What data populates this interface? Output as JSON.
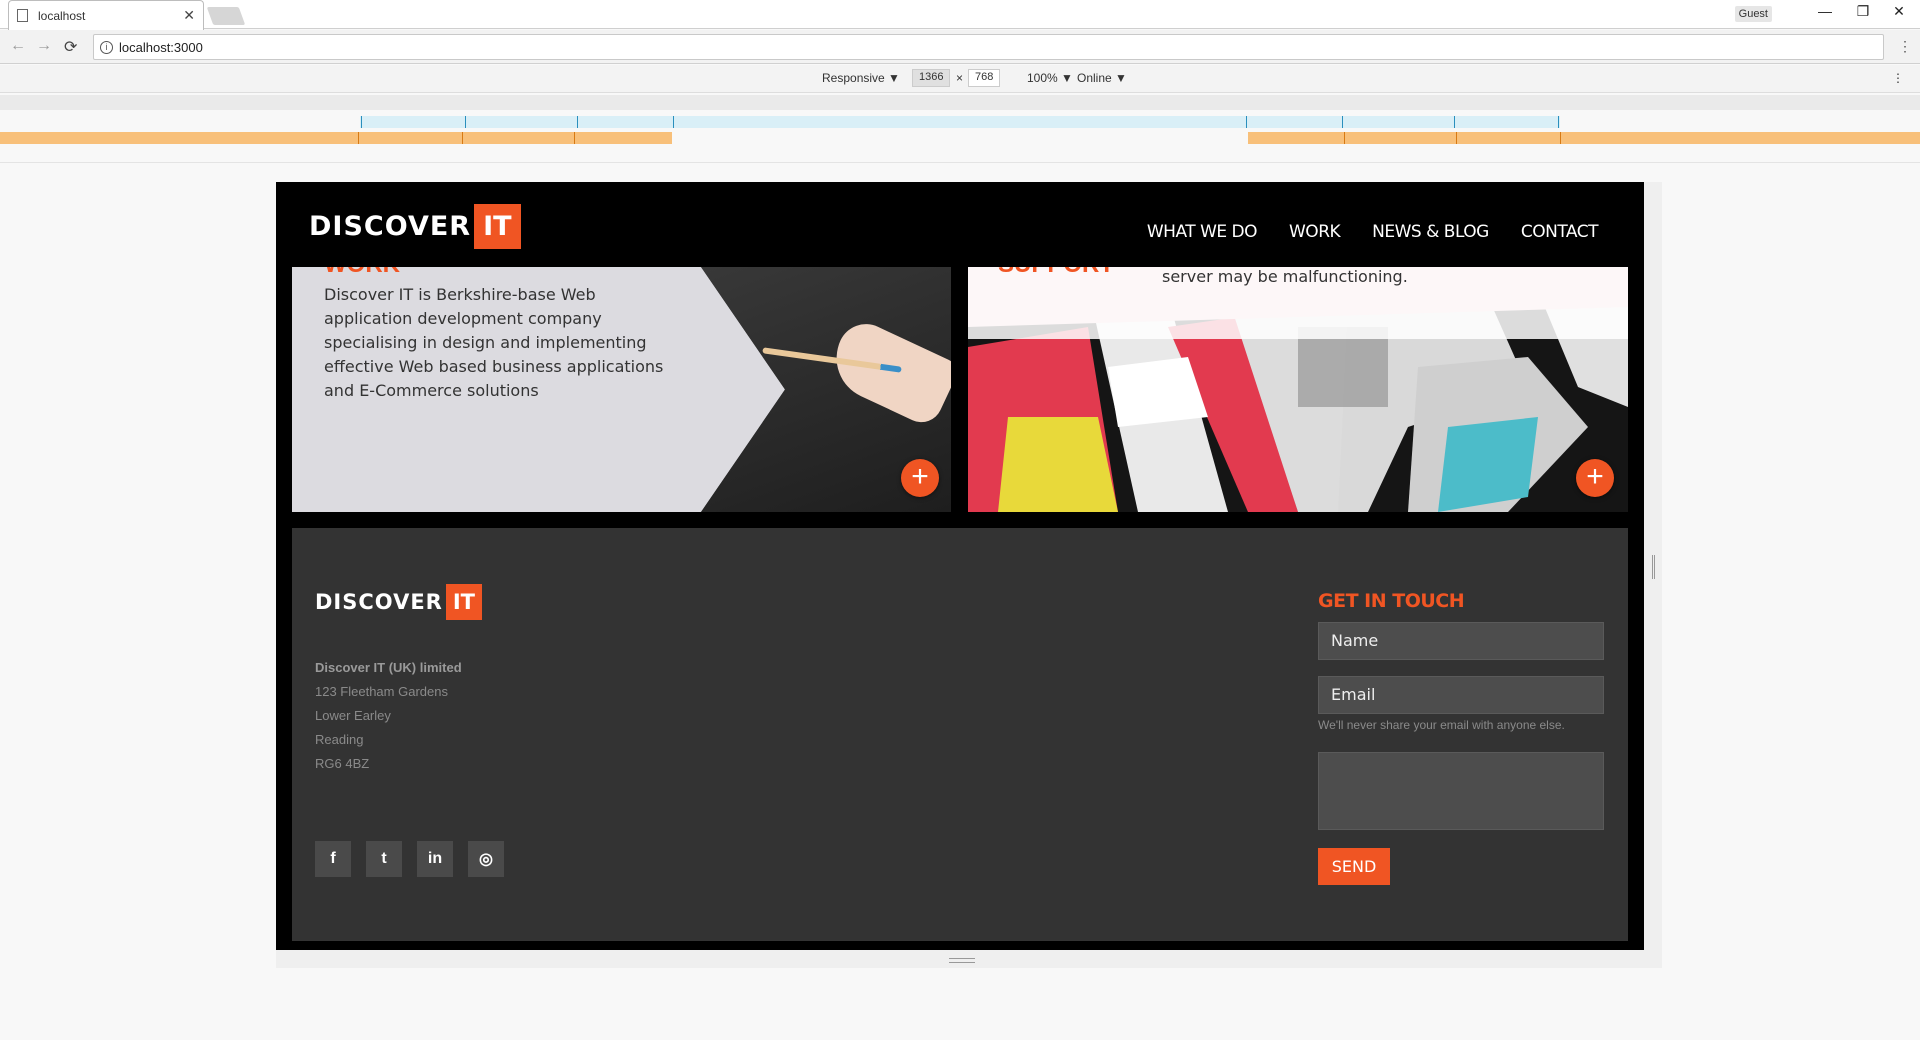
{
  "browser": {
    "tab_title": "localhost",
    "tab_close": "✕",
    "guest_label": "Guest",
    "url": "localhost:3000",
    "window_controls": {
      "minimize": "—",
      "restore": "❐",
      "close": "✕"
    }
  },
  "devtools": {
    "device": "Responsive ▼",
    "width": "1366",
    "times": "×",
    "height": "768",
    "zoom": "100% ▼",
    "network": "Online ▼",
    "more": "⋮"
  },
  "site": {
    "logo_word": "DISCOVER",
    "logo_it": "IT",
    "nav": [
      "WHAT WE DO",
      "WORK",
      "NEWS & BLOG",
      "CONTACT"
    ],
    "cards": {
      "left_title_fragment": "WORK",
      "left_text": "Discover IT is Berkshire-base Web application development company specialising in design and implementing effective Web based business applications and E-Commerce solutions",
      "right_title_fragment": "SUPPORT",
      "right_text": "server may be malfunctioning.",
      "plus": "+"
    },
    "footer": {
      "logo_word": "DISCOVER",
      "logo_it": "IT",
      "address": {
        "company": "Discover IT (UK) limited",
        "line1": "123 Fleetham Gardens",
        "line2": "Lower Earley",
        "line3": "Reading",
        "postcode": "RG6 4BZ"
      },
      "social": {
        "facebook": "f",
        "twitter": "t",
        "linkedin": "in",
        "instagram": "◎"
      },
      "contact": {
        "heading": "GET IN TOUCH",
        "name_placeholder": "Name",
        "email_placeholder": "Email",
        "email_hint": "We'll never share your email with anyone else.",
        "send_label": "SEND"
      }
    }
  },
  "colors": {
    "accent": "#f05523",
    "footer_bg": "#333333"
  }
}
